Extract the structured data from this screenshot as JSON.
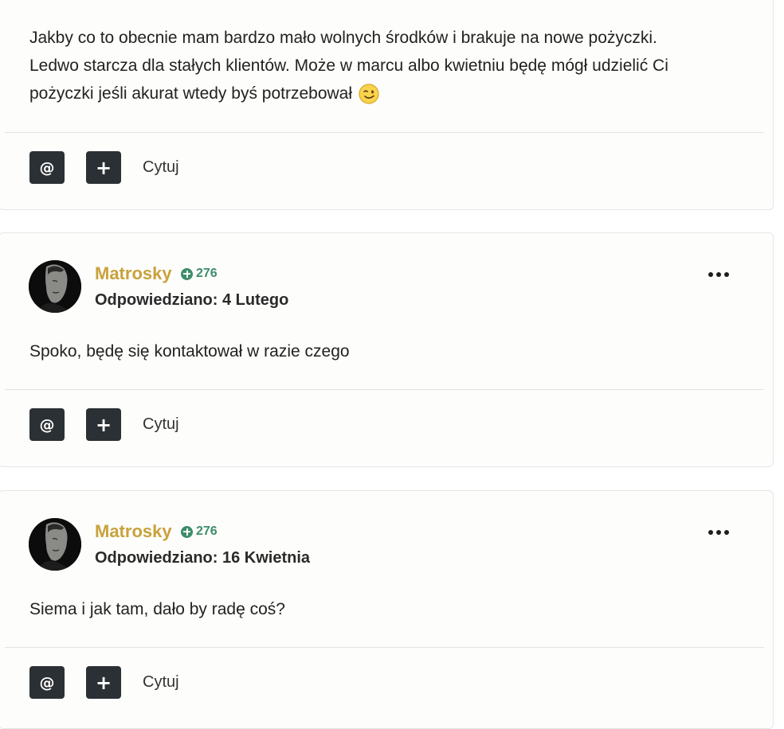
{
  "actions": {
    "mention_symbol": "@",
    "plus_symbol": "+",
    "quote_label": "Cytuj"
  },
  "posts": [
    {
      "text_lines": [
        "Jakby co to obecnie mam bardzo mało wolnych środków i brakuje na nowe pożyczki.",
        "Ledwo starcza dla stałych klientów. Może w marcu albo kwietniu będę mógł udzielić Ci",
        "pożyczki jeśli akurat wtedy byś potrzebował"
      ],
      "emoji": "wink-emoji-icon"
    },
    {
      "author": "Matrosky",
      "reputation": "276",
      "date": "Odpowiedziano: 4 Lutego",
      "text": "Spoko, będę się kontaktował w razie czego"
    },
    {
      "author": "Matrosky",
      "reputation": "276",
      "date": "Odpowiedziano: 16 Kwietnia",
      "text": "Siema i jak tam, dało by radę coś?"
    }
  ],
  "colors": {
    "author": "#c9a23c",
    "reputation": "#3d8d6a",
    "button_bg": "#2b3034"
  }
}
